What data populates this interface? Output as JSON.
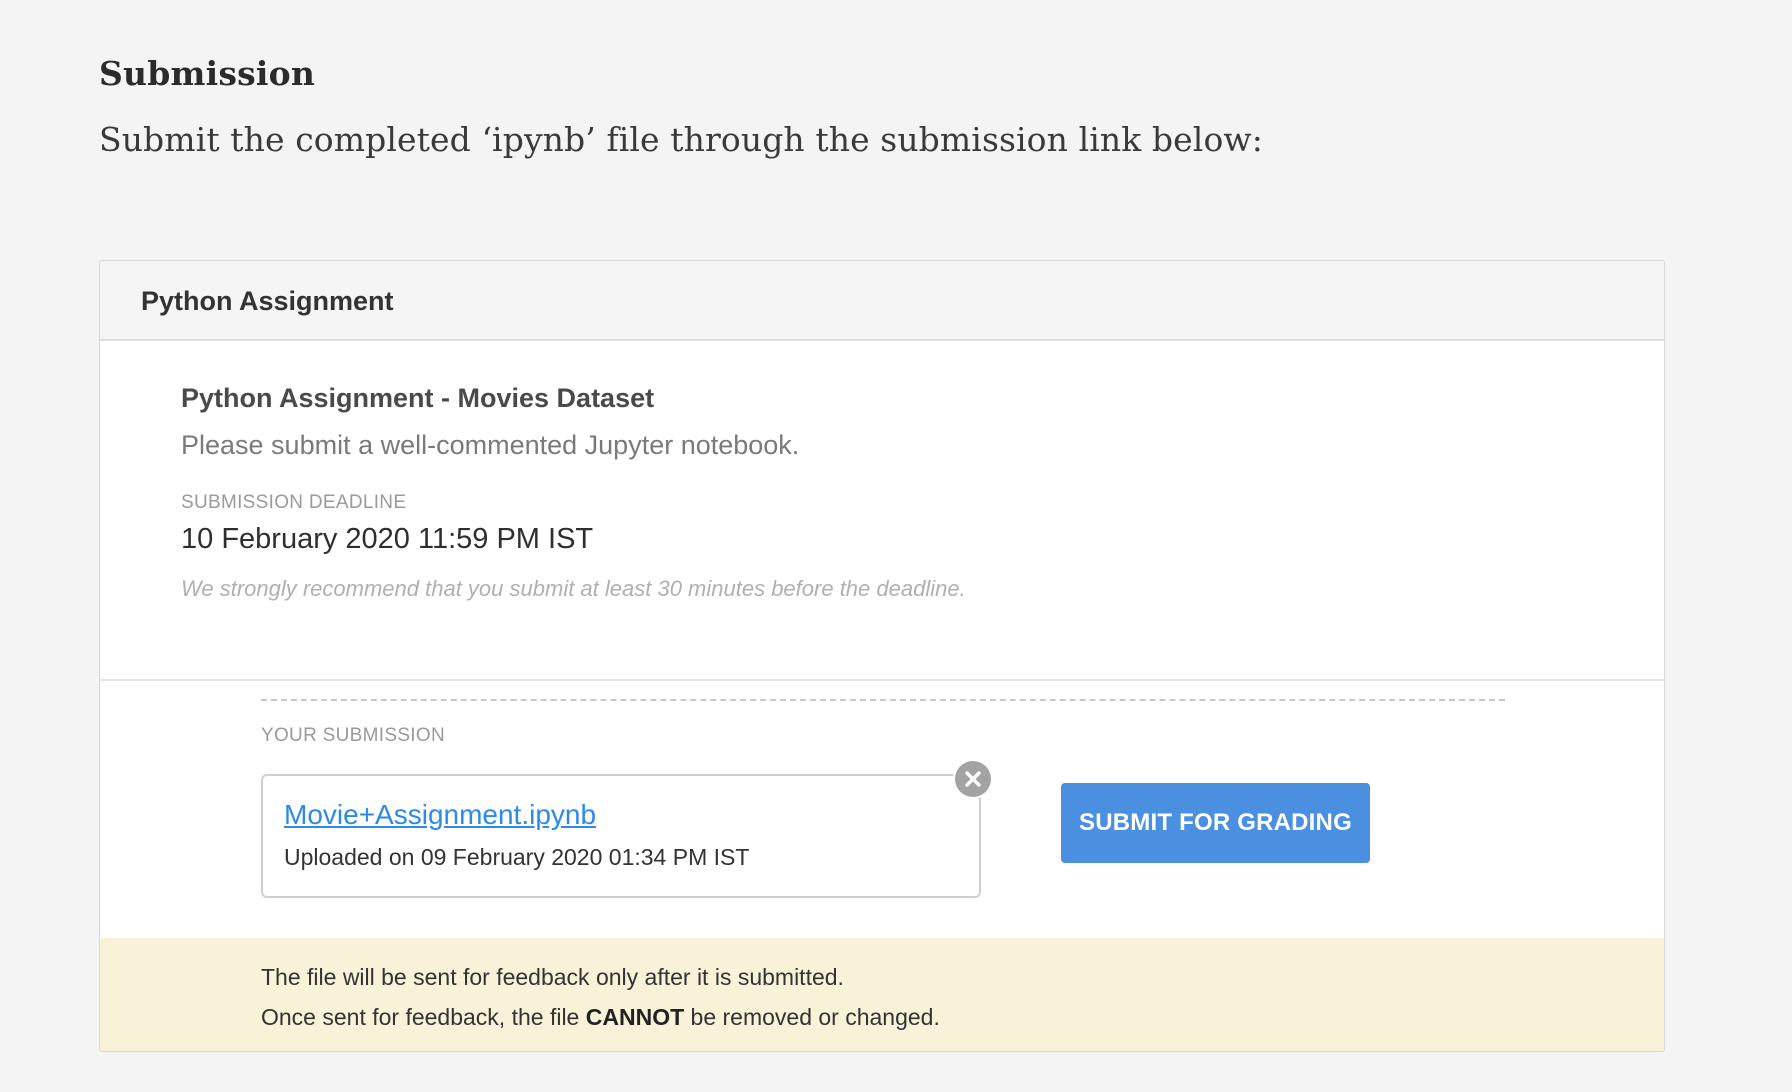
{
  "page": {
    "heading": "Submission",
    "intro": "Submit the completed ‘ipynb’ file through the submission link below:"
  },
  "card": {
    "header_title": "Python Assignment",
    "assignment_title": "Python Assignment - Movies Dataset",
    "assignment_description": "Please submit a well-commented Jupyter notebook.",
    "deadline_label": "SUBMISSION DEADLINE",
    "deadline_value": "10 February 2020 11:59 PM IST",
    "deadline_note": "We strongly recommend that you submit at least 30 minutes before the deadline."
  },
  "submission": {
    "label": "YOUR SUBMISSION",
    "file_name": "Movie+Assignment.ipynb",
    "uploaded_text": "Uploaded on 09 February 2020 01:34 PM IST",
    "remove_icon": "close-icon",
    "submit_label": "SUBMIT FOR GRADING"
  },
  "notice": {
    "line1": "The file will be sent for feedback only after it is submitted.",
    "line2_prefix": "Once sent for feedback, the file ",
    "line2_emphasis": "CANNOT",
    "line2_suffix": " be removed or changed."
  },
  "colors": {
    "page_background": "#f4f4f4",
    "card_header_background": "#f5f5f5",
    "link": "#2d8ae8",
    "submit_button": "#4a8fe0",
    "notice_background": "#f8f3d8",
    "remove_button": "#a3a3a3"
  }
}
